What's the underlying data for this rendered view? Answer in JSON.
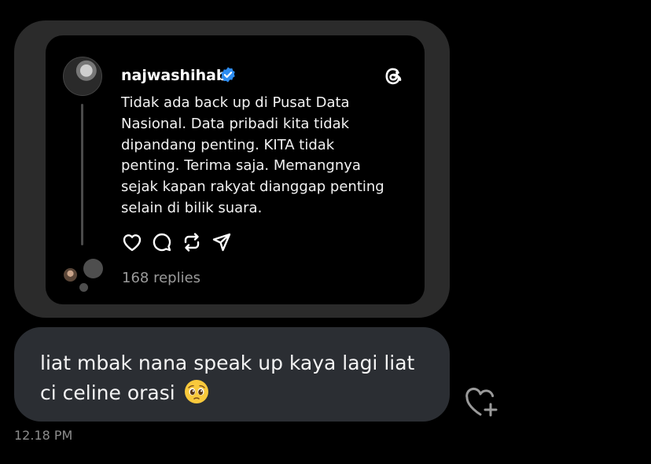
{
  "post": {
    "username": "najwashihab",
    "text": "Tidak ada back up di Pusat Data\nNasional. Data pribadi kita tidak\ndipandang penting. KITA tidak\npenting. Terima saja. Memangnya\nsejak kapan rakyat dianggap penting\nselain di bilik suara.",
    "replies": "168 replies",
    "verified_color": "#2d8cf0",
    "icons": [
      "heart-icon",
      "comment-icon",
      "repost-icon",
      "share-icon",
      "threads-logo-icon"
    ]
  },
  "message": {
    "text": "liat mbak nana speak up kaya lagi liat\nci celine orasi",
    "emoji": "pleading-face",
    "timestamp": "12.18 PM"
  },
  "colors": {
    "background": "#000000",
    "bubble": "#2b2e33",
    "outer_card": "#2b2b2b"
  }
}
